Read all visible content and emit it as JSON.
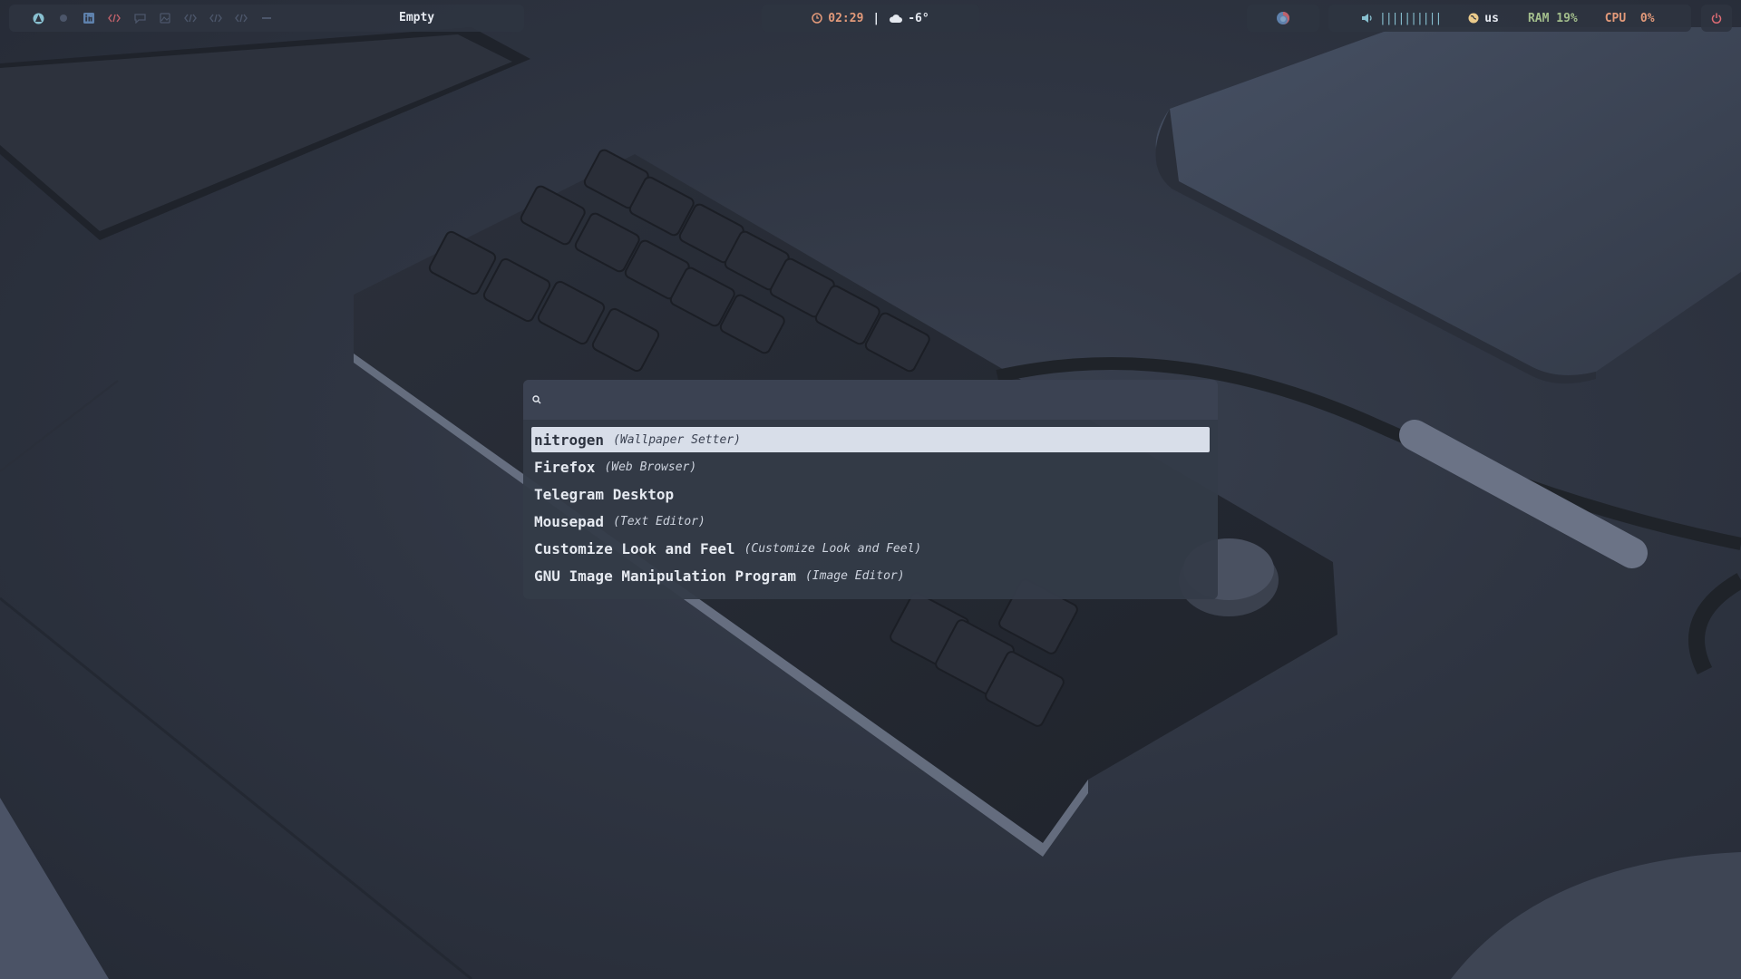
{
  "colors": {
    "bar_bg": "#2e3440",
    "accent_clock": "#e39a7a",
    "ram": "#a3be8c",
    "cpu": "#e39a7a",
    "volume": "#88c0d0",
    "power": "#e06c75",
    "launcher_selected_bg": "#d8dee9"
  },
  "topbar": {
    "workspaces": [
      {
        "icon": "arch-icon",
        "color": "#88c0d0",
        "active": true
      },
      {
        "icon": "dot-icon",
        "color": "#4c566a",
        "active": false
      },
      {
        "icon": "linkedin-icon",
        "color": "#5e81ac",
        "active": false
      },
      {
        "icon": "code-icon",
        "color": "#bf616a",
        "active": false
      },
      {
        "icon": "chat-icon",
        "color": "#4c566a",
        "active": false
      },
      {
        "icon": "image-icon",
        "color": "#4c566a",
        "active": false
      },
      {
        "icon": "code-icon",
        "color": "#4c566a",
        "active": false
      },
      {
        "icon": "code-icon",
        "color": "#4c566a",
        "active": false
      },
      {
        "icon": "code-icon",
        "color": "#4c566a",
        "active": false
      },
      {
        "icon": "minus-icon",
        "color": "#4c566a",
        "active": false
      }
    ],
    "window_title": "Empty",
    "clock": {
      "icon": "clock-icon",
      "time": "02:29"
    },
    "separator": "|",
    "weather": {
      "icon": "cloud-icon",
      "temp": "-6°"
    },
    "tray": [
      {
        "icon": "firefox-icon"
      }
    ],
    "volume": {
      "icon": "speaker-icon",
      "level_bars": "||||||||||"
    },
    "keyboard": {
      "icon": "globe-icon",
      "layout": "us"
    },
    "ram": "RAM 19%",
    "cpu": "CPU  0%",
    "power": {
      "icon": "power-icon"
    }
  },
  "launcher": {
    "prompt_icon": "search-icon",
    "query": "",
    "items": [
      {
        "name": "nitrogen",
        "desc": "(Wallpaper Setter)",
        "selected": true
      },
      {
        "name": "Firefox",
        "desc": "(Web Browser)",
        "selected": false
      },
      {
        "name": "Telegram Desktop",
        "desc": "",
        "selected": false
      },
      {
        "name": "Mousepad",
        "desc": "(Text Editor)",
        "selected": false
      },
      {
        "name": "Customize Look and Feel",
        "desc": "(Customize Look and Feel)",
        "selected": false
      },
      {
        "name": "GNU Image Manipulation Program",
        "desc": "(Image Editor)",
        "selected": false
      }
    ]
  }
}
